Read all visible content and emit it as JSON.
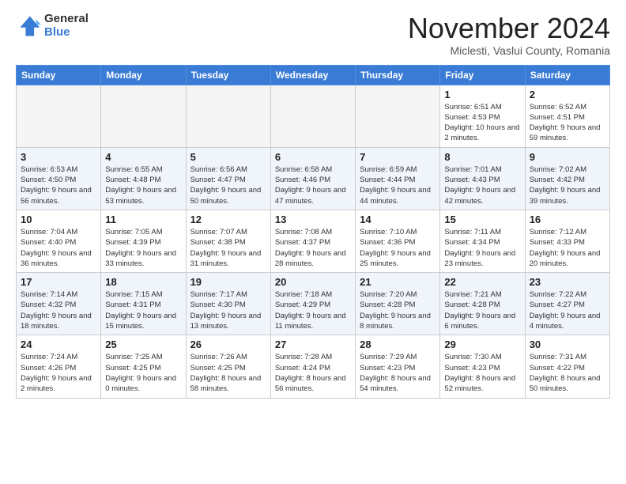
{
  "logo": {
    "general": "General",
    "blue": "Blue"
  },
  "title": "November 2024",
  "location": "Miclesti, Vaslui County, Romania",
  "headers": [
    "Sunday",
    "Monday",
    "Tuesday",
    "Wednesday",
    "Thursday",
    "Friday",
    "Saturday"
  ],
  "weeks": [
    [
      {
        "day": "",
        "empty": true
      },
      {
        "day": "",
        "empty": true
      },
      {
        "day": "",
        "empty": true
      },
      {
        "day": "",
        "empty": true
      },
      {
        "day": "",
        "empty": true
      },
      {
        "day": "1",
        "rise": "6:51 AM",
        "set": "4:53 PM",
        "daylight": "10 hours and 2 minutes."
      },
      {
        "day": "2",
        "rise": "6:52 AM",
        "set": "4:51 PM",
        "daylight": "9 hours and 59 minutes."
      }
    ],
    [
      {
        "day": "3",
        "rise": "6:53 AM",
        "set": "4:50 PM",
        "daylight": "9 hours and 56 minutes."
      },
      {
        "day": "4",
        "rise": "6:55 AM",
        "set": "4:48 PM",
        "daylight": "9 hours and 53 minutes."
      },
      {
        "day": "5",
        "rise": "6:56 AM",
        "set": "4:47 PM",
        "daylight": "9 hours and 50 minutes."
      },
      {
        "day": "6",
        "rise": "6:58 AM",
        "set": "4:46 PM",
        "daylight": "9 hours and 47 minutes."
      },
      {
        "day": "7",
        "rise": "6:59 AM",
        "set": "4:44 PM",
        "daylight": "9 hours and 44 minutes."
      },
      {
        "day": "8",
        "rise": "7:01 AM",
        "set": "4:43 PM",
        "daylight": "9 hours and 42 minutes."
      },
      {
        "day": "9",
        "rise": "7:02 AM",
        "set": "4:42 PM",
        "daylight": "9 hours and 39 minutes."
      }
    ],
    [
      {
        "day": "10",
        "rise": "7:04 AM",
        "set": "4:40 PM",
        "daylight": "9 hours and 36 minutes."
      },
      {
        "day": "11",
        "rise": "7:05 AM",
        "set": "4:39 PM",
        "daylight": "9 hours and 33 minutes."
      },
      {
        "day": "12",
        "rise": "7:07 AM",
        "set": "4:38 PM",
        "daylight": "9 hours and 31 minutes."
      },
      {
        "day": "13",
        "rise": "7:08 AM",
        "set": "4:37 PM",
        "daylight": "9 hours and 28 minutes."
      },
      {
        "day": "14",
        "rise": "7:10 AM",
        "set": "4:36 PM",
        "daylight": "9 hours and 25 minutes."
      },
      {
        "day": "15",
        "rise": "7:11 AM",
        "set": "4:34 PM",
        "daylight": "9 hours and 23 minutes."
      },
      {
        "day": "16",
        "rise": "7:12 AM",
        "set": "4:33 PM",
        "daylight": "9 hours and 20 minutes."
      }
    ],
    [
      {
        "day": "17",
        "rise": "7:14 AM",
        "set": "4:32 PM",
        "daylight": "9 hours and 18 minutes."
      },
      {
        "day": "18",
        "rise": "7:15 AM",
        "set": "4:31 PM",
        "daylight": "9 hours and 15 minutes."
      },
      {
        "day": "19",
        "rise": "7:17 AM",
        "set": "4:30 PM",
        "daylight": "9 hours and 13 minutes."
      },
      {
        "day": "20",
        "rise": "7:18 AM",
        "set": "4:29 PM",
        "daylight": "9 hours and 11 minutes."
      },
      {
        "day": "21",
        "rise": "7:20 AM",
        "set": "4:28 PM",
        "daylight": "9 hours and 8 minutes."
      },
      {
        "day": "22",
        "rise": "7:21 AM",
        "set": "4:28 PM",
        "daylight": "9 hours and 6 minutes."
      },
      {
        "day": "23",
        "rise": "7:22 AM",
        "set": "4:27 PM",
        "daylight": "9 hours and 4 minutes."
      }
    ],
    [
      {
        "day": "24",
        "rise": "7:24 AM",
        "set": "4:26 PM",
        "daylight": "9 hours and 2 minutes."
      },
      {
        "day": "25",
        "rise": "7:25 AM",
        "set": "4:25 PM",
        "daylight": "9 hours and 0 minutes."
      },
      {
        "day": "26",
        "rise": "7:26 AM",
        "set": "4:25 PM",
        "daylight": "8 hours and 58 minutes."
      },
      {
        "day": "27",
        "rise": "7:28 AM",
        "set": "4:24 PM",
        "daylight": "8 hours and 56 minutes."
      },
      {
        "day": "28",
        "rise": "7:29 AM",
        "set": "4:23 PM",
        "daylight": "8 hours and 54 minutes."
      },
      {
        "day": "29",
        "rise": "7:30 AM",
        "set": "4:23 PM",
        "daylight": "8 hours and 52 minutes."
      },
      {
        "day": "30",
        "rise": "7:31 AM",
        "set": "4:22 PM",
        "daylight": "8 hours and 50 minutes."
      }
    ]
  ]
}
